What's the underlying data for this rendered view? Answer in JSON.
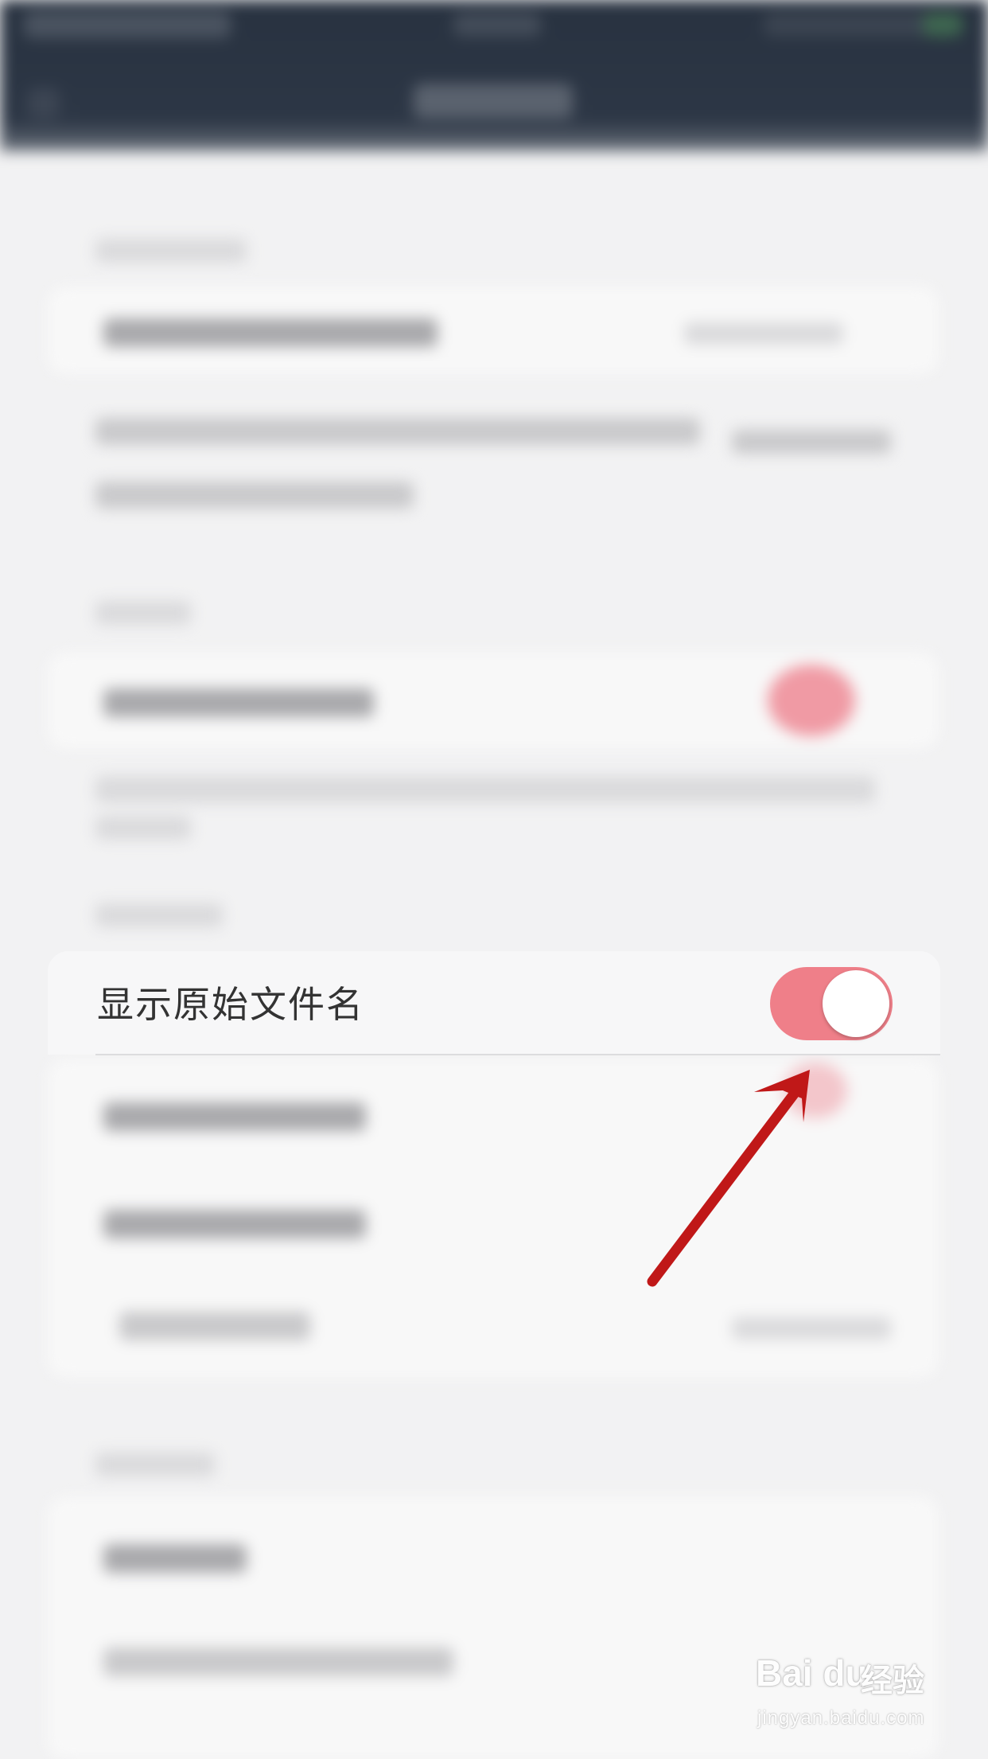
{
  "setting": {
    "label": "显示原始文件名",
    "toggle_on": true,
    "toggle_color": "#ef7f89"
  },
  "annotation": {
    "arrow_color": "#c01818"
  },
  "watermark": {
    "logo": "Bai du",
    "name": "经验",
    "url": "jingyan.baidu.com"
  }
}
